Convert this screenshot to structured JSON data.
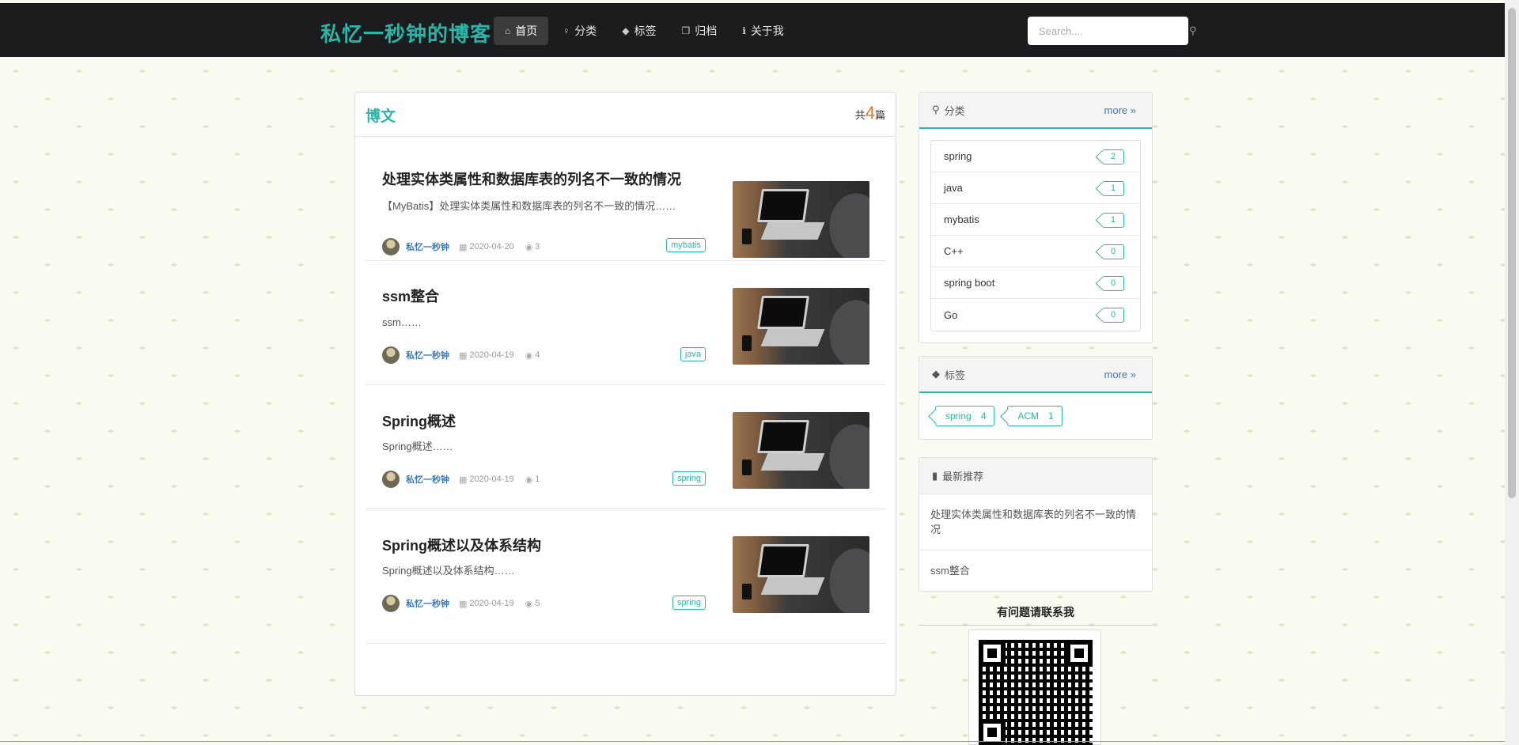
{
  "site": {
    "logo": "私忆一秒钟的博客"
  },
  "nav": {
    "items": [
      {
        "icon": "home-icon",
        "glyph": "⌂",
        "label": "首页",
        "active": true
      },
      {
        "icon": "lightbulb-icon",
        "glyph": "♀",
        "label": "分类",
        "active": false
      },
      {
        "icon": "tags-icon",
        "glyph": "◆",
        "label": "标签",
        "active": false
      },
      {
        "icon": "archive-icon",
        "glyph": "❐",
        "label": "归档",
        "active": false
      },
      {
        "icon": "info-icon",
        "glyph": "ℹ",
        "label": "关于我",
        "active": false
      }
    ]
  },
  "search": {
    "placeholder": "Search....",
    "icon": "search-icon"
  },
  "main": {
    "title": "博文",
    "count_prefix": "共",
    "count": "4",
    "count_suffix": "篇",
    "posts": [
      {
        "title": "处理实体类属性和数据库表的列名不一致的情况",
        "excerpt": "【MyBatis】处理实体类属性和数据库表的列名不一致的情况……",
        "author": "私忆一秒钟",
        "date": "2020-04-20",
        "views": "3",
        "tag": "mybatis"
      },
      {
        "title": "ssm整合",
        "excerpt": "ssm……",
        "author": "私忆一秒钟",
        "date": "2020-04-19",
        "views": "4",
        "tag": "java"
      },
      {
        "title": "Spring概述",
        "excerpt": "Spring概述……",
        "author": "私忆一秒钟",
        "date": "2020-04-19",
        "views": "1",
        "tag": "spring"
      },
      {
        "title": "Spring概述以及体系结构",
        "excerpt": "Spring概述以及体系结构……",
        "author": "私忆一秒钟",
        "date": "2020-04-19",
        "views": "5",
        "tag": "spring"
      }
    ]
  },
  "sidebar": {
    "categories": {
      "title": "分类",
      "more": "more",
      "items": [
        {
          "name": "spring",
          "count": "2"
        },
        {
          "name": "java",
          "count": "1"
        },
        {
          "name": "mybatis",
          "count": "1"
        },
        {
          "name": "C++",
          "count": "0"
        },
        {
          "name": "spring boot",
          "count": "0"
        },
        {
          "name": "Go",
          "count": "0"
        }
      ]
    },
    "tags": {
      "title": "标签",
      "more": "more",
      "items": [
        {
          "name": "spring",
          "count": "4"
        },
        {
          "name": "ACM",
          "count": "1"
        }
      ]
    },
    "recommend": {
      "title": "最新推荐",
      "items": [
        "处理实体类属性和数据库表的列名不一致的情况",
        "ssm整合"
      ]
    },
    "contact": {
      "title": "有问题请联系我"
    }
  },
  "colors": {
    "accent": "#2bb5a8",
    "navbar": "#1b1c1d",
    "link": "#3a7ab8",
    "count": "#e0752b"
  }
}
